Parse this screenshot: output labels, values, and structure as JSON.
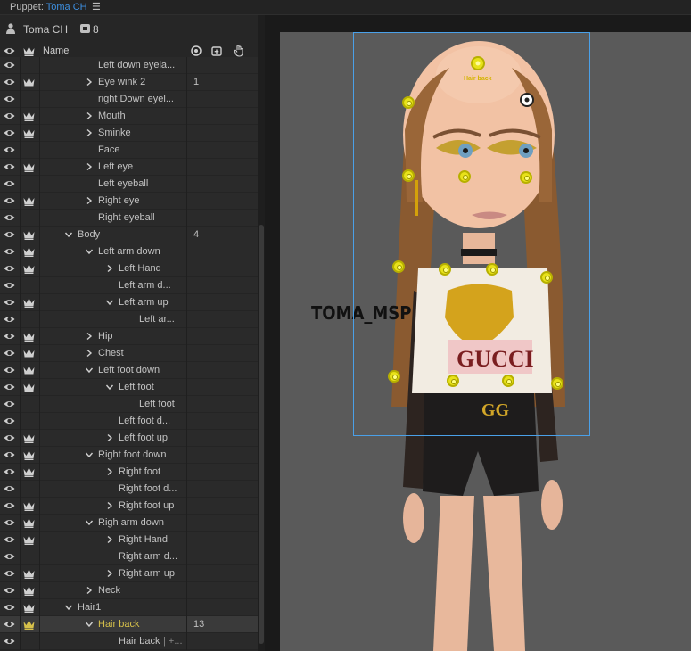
{
  "window": {
    "panel_label": "Puppet:",
    "puppet_link": "Toma CH",
    "menu_icon": "hamburger-icon"
  },
  "puppet": {
    "name": "Toma CH",
    "count": "8"
  },
  "columns": {
    "name": "Name"
  },
  "rows": [
    {
      "label": "Left down eyela...",
      "num": ""
    },
    {
      "label": "Eye wink 2",
      "num": "1"
    },
    {
      "label": "right Down eyel...",
      "num": ""
    },
    {
      "label": "Mouth",
      "num": ""
    },
    {
      "label": "Sminke",
      "num": ""
    },
    {
      "label": "Face",
      "num": ""
    },
    {
      "label": "Left eye",
      "num": ""
    },
    {
      "label": "Left eyeball",
      "num": ""
    },
    {
      "label": "Right eye",
      "num": ""
    },
    {
      "label": "Right eyeball",
      "num": ""
    },
    {
      "label": "Body",
      "num": "4"
    },
    {
      "label": "Left arm down",
      "num": ""
    },
    {
      "label": "Left Hand",
      "num": ""
    },
    {
      "label": "Left arm d...",
      "num": ""
    },
    {
      "label": "Left arm up",
      "num": ""
    },
    {
      "label": "Left ar...",
      "num": ""
    },
    {
      "label": "Hip",
      "num": ""
    },
    {
      "label": "Chest",
      "num": ""
    },
    {
      "label": "Left foot down",
      "num": ""
    },
    {
      "label": "Left foot",
      "num": ""
    },
    {
      "label": "Left foot",
      "num": ""
    },
    {
      "label": "Left foot d...",
      "num": ""
    },
    {
      "label": "Left foot up",
      "num": ""
    },
    {
      "label": "Right foot down",
      "num": ""
    },
    {
      "label": "Right foot",
      "num": ""
    },
    {
      "label": "Right foot d...",
      "num": ""
    },
    {
      "label": "Right foot up",
      "num": ""
    },
    {
      "label": "Righ arm down",
      "num": ""
    },
    {
      "label": "Right Hand",
      "num": ""
    },
    {
      "label": "Right arm d...",
      "num": ""
    },
    {
      "label": "Right arm up",
      "num": ""
    },
    {
      "label": "Neck",
      "num": ""
    },
    {
      "label": "Hair1",
      "num": ""
    },
    {
      "label": "Hair back",
      "num": "13"
    },
    {
      "label": "Hair back",
      "num": ""
    }
  ],
  "row_suffix": "| +...",
  "stage": {
    "watermark": "TOMA_MSP",
    "hair_back_label": "Hair back",
    "shirt_brand": "GUCCI",
    "belt_logo": "GG"
  },
  "colors": {
    "accent": "#3d8fe0",
    "selection_box": "#4aa0e8",
    "handle": "#e8e21a",
    "selected_text": "#d6c04a"
  }
}
